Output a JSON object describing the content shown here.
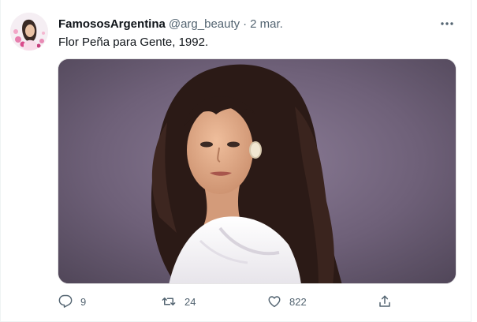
{
  "tweet": {
    "display_name": "FamososArgentina",
    "handle": "@arg_beauty",
    "separator": "·",
    "date": "2 mar.",
    "text": "Flor Peña para Gente, 1992."
  },
  "actions": {
    "reply_count": "9",
    "retweet_count": "24",
    "like_count": "822"
  },
  "colors": {
    "text_primary": "#0f1419",
    "text_secondary": "#536471",
    "border": "#eff3f4"
  },
  "icons": {
    "more": "more-horizontal-icon",
    "reply": "reply-icon",
    "retweet": "retweet-icon",
    "like": "heart-icon",
    "share": "share-icon"
  }
}
